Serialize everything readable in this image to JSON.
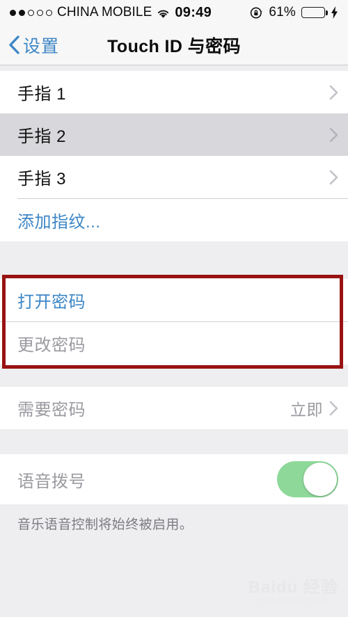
{
  "status_bar": {
    "signal_dots_total": 5,
    "signal_dots_filled": 2,
    "carrier": "CHINA MOBILE",
    "wifi_icon": "wifi-icon",
    "time": "09:49",
    "rotation_lock_icon": "rotation-lock-icon",
    "battery_percent_label": "61%",
    "battery_level": 61,
    "battery_color": "#4cd350",
    "charging_icon": "charging-bolt-icon"
  },
  "navbar": {
    "back_icon": "chevron-left-icon",
    "back_label": "设置",
    "title": "Touch ID 与密码",
    "accent_color": "#3d86c6"
  },
  "fingerprints": {
    "rows": [
      {
        "label": "手指 1",
        "selected": false,
        "chevron": "chevron-right-icon"
      },
      {
        "label": "手指 2",
        "selected": true,
        "chevron": "chevron-right-icon"
      },
      {
        "label": "手指 3",
        "selected": false,
        "chevron": "chevron-right-icon"
      }
    ],
    "add_label": "添加指纹..."
  },
  "passcode": {
    "turn_on_label": "打开密码",
    "change_label": "更改密码",
    "highlight_color": "#991312",
    "highlight_target": "打开密码"
  },
  "require": {
    "label": "需要密码",
    "value": "立即",
    "chevron": "chevron-right-icon"
  },
  "voice_dial": {
    "label": "语音拨号",
    "toggle_on": true,
    "toggle_color": "#8ed99a",
    "footer": "音乐语音控制将始终被启用。"
  },
  "watermark": {
    "brand": "Baidu 经验",
    "sub": "jingyan.baidu.com"
  }
}
